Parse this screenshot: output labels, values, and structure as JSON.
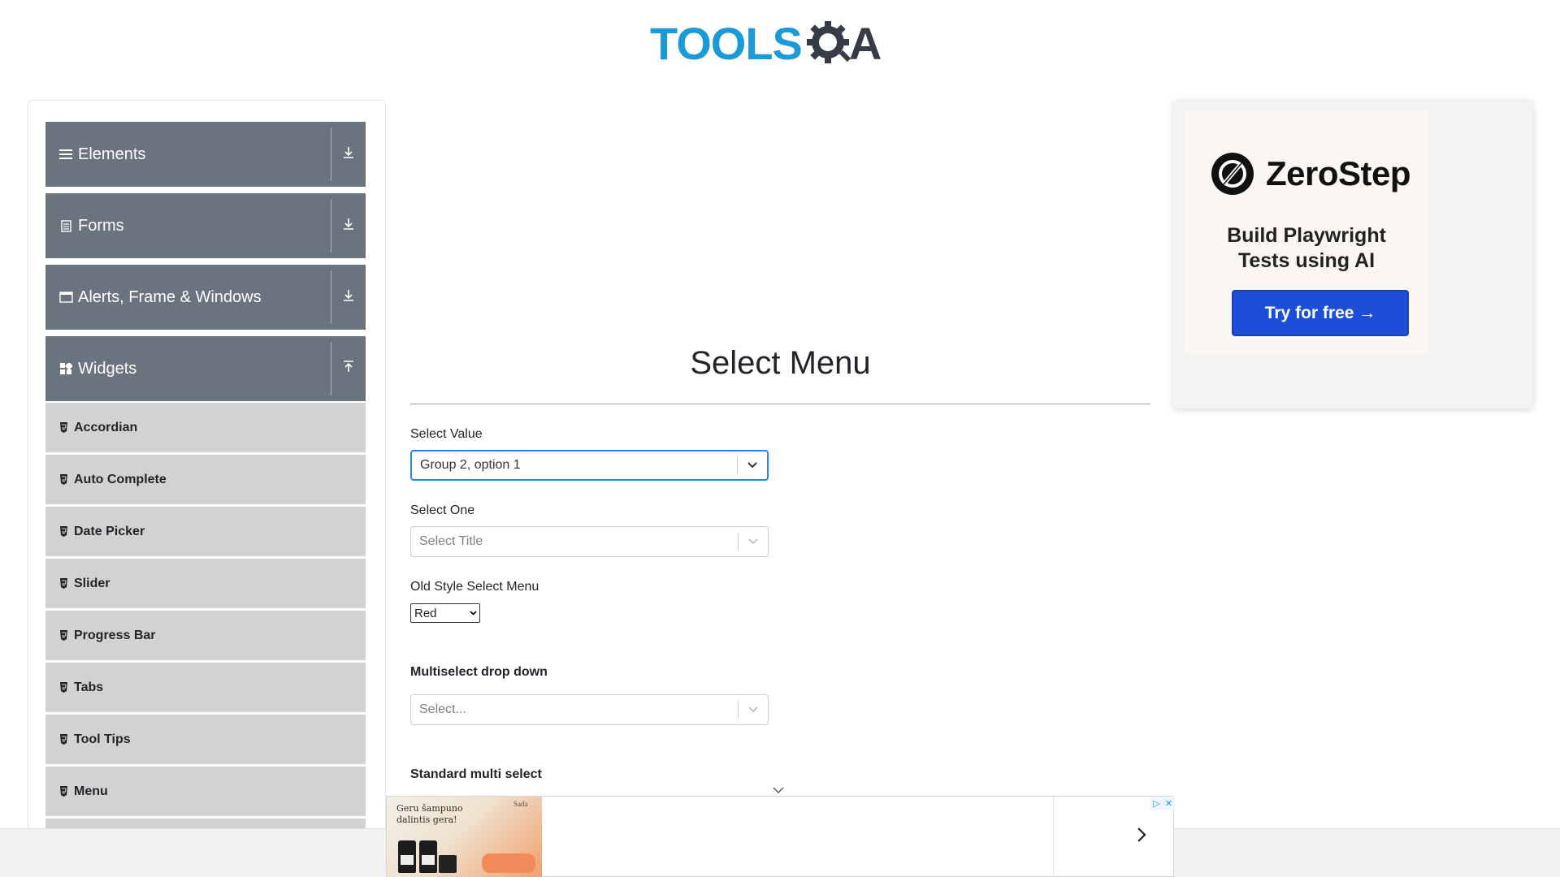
{
  "header": {
    "logo_tools": "TOOLS",
    "logo_a": "A"
  },
  "sidebar": {
    "groups": [
      {
        "label": "Elements",
        "icon": "list-icon",
        "arrow": "down"
      },
      {
        "label": "Forms",
        "icon": "form-icon",
        "arrow": "down"
      },
      {
        "label": "Alerts, Frame & Windows",
        "icon": "window-icon",
        "arrow": "down"
      },
      {
        "label": "Widgets",
        "icon": "widgets-icon",
        "arrow": "up"
      }
    ],
    "items": [
      {
        "label": "Accordian"
      },
      {
        "label": "Auto Complete"
      },
      {
        "label": "Date Picker"
      },
      {
        "label": "Slider"
      },
      {
        "label": "Progress Bar"
      },
      {
        "label": "Tabs"
      },
      {
        "label": "Tool Tips"
      },
      {
        "label": "Menu"
      }
    ]
  },
  "main": {
    "title": "Select Menu",
    "select_value": {
      "label": "Select Value",
      "value": "Group 2, option 1"
    },
    "select_one": {
      "label": "Select One",
      "placeholder": "Select Title"
    },
    "old_style": {
      "label": "Old Style Select Menu",
      "value": "Red"
    },
    "multiselect": {
      "label": "Multiselect drop down",
      "placeholder": "Select..."
    },
    "standard_multi": {
      "label": "Standard multi select"
    }
  },
  "ad_right": {
    "brand": "ZeroStep",
    "tagline_1": "Build Playwright",
    "tagline_2": "Tests using AI",
    "button": "Try for free →"
  },
  "ad_bottom": {
    "text": "Geru šampuno dalintis gera!",
    "brand": "Sada",
    "next": "›"
  },
  "colors": {
    "logo_blue": "#1a9ad6",
    "sidebar_group_bg": "#6b747e",
    "sidebar_item_bg": "#d2d2d2",
    "focus_blue": "#2684ff",
    "cta_blue": "#1d4ed8"
  }
}
